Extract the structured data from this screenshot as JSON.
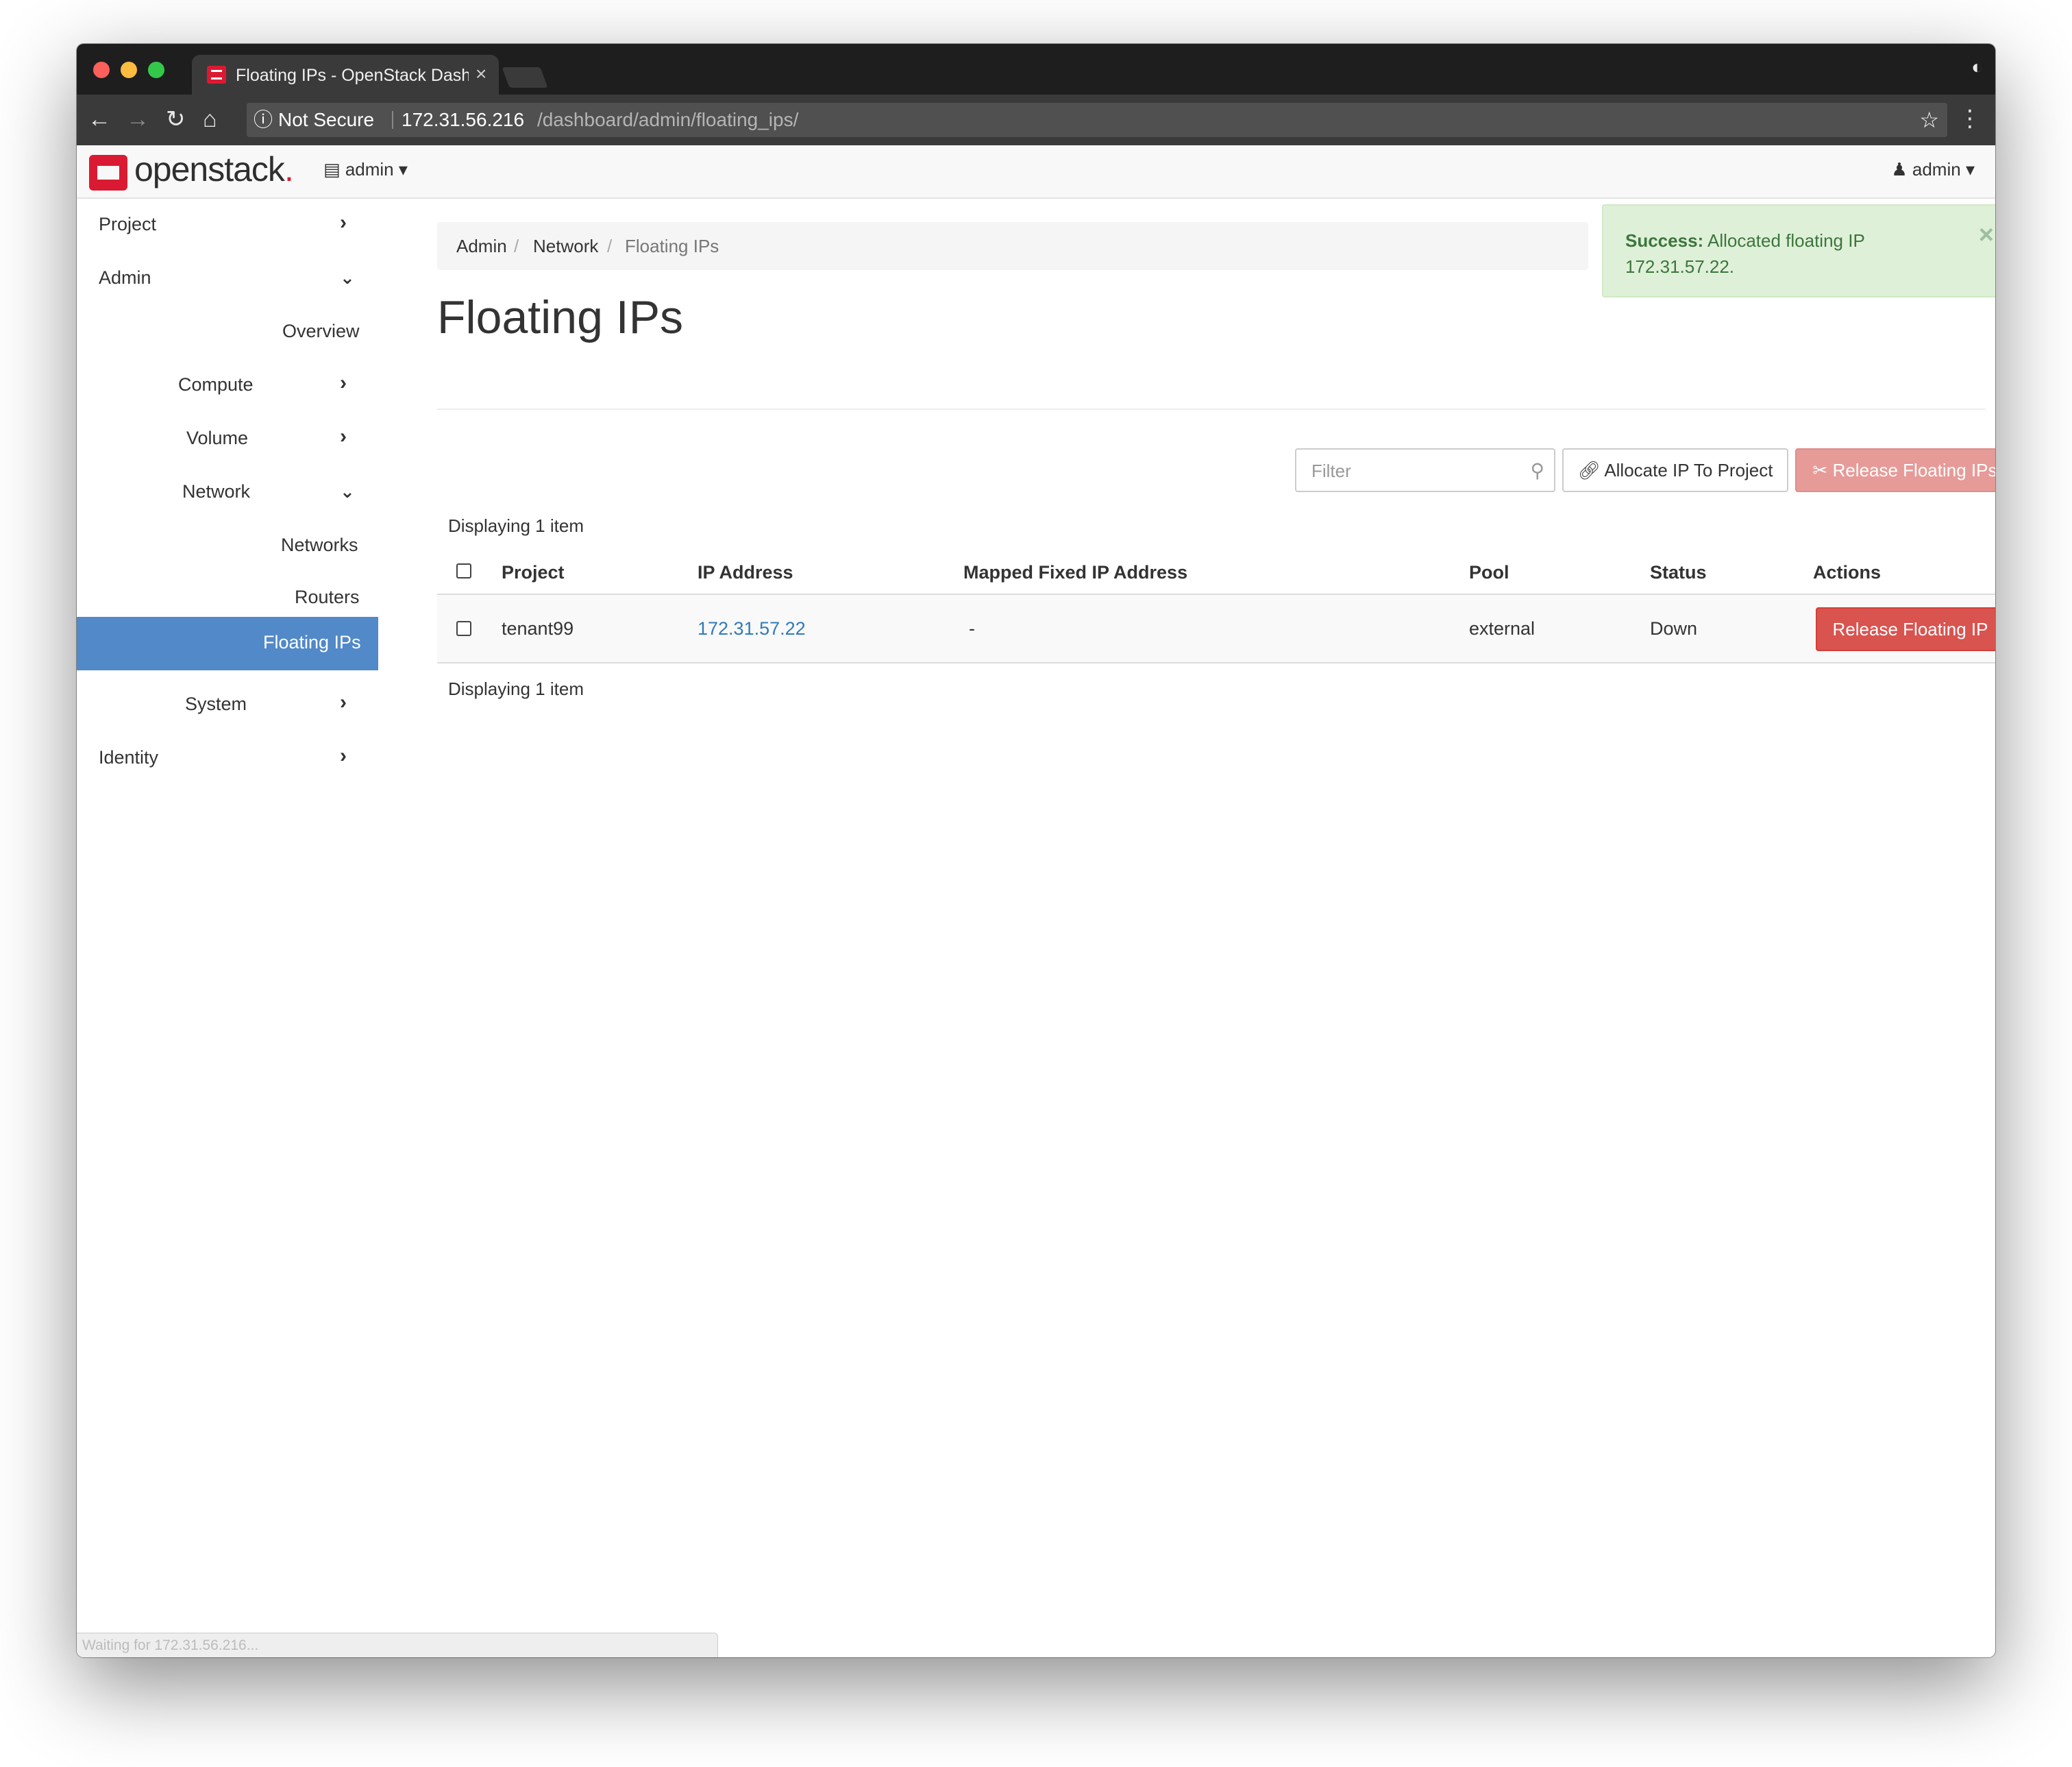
{
  "browser": {
    "tab_title": "Floating IPs - OpenStack Dashboard",
    "tab_close": "×",
    "security_label": "Not Secure",
    "url_host": "172.31.56.216",
    "url_path": "/dashboard/admin/floating_ips/",
    "status_text": "Waiting for 172.31.56.216..."
  },
  "appbar": {
    "logo_text": "openstack",
    "logo_dot": ".",
    "project_label": "admin",
    "user_label": "admin"
  },
  "sidebar": {
    "items": [
      {
        "label": "Project",
        "chevron": "right"
      },
      {
        "label": "Admin",
        "chevron": "down"
      },
      {
        "label": "Overview"
      },
      {
        "label": "Compute",
        "chevron": "right"
      },
      {
        "label": "Volume",
        "chevron": "right"
      },
      {
        "label": "Network",
        "chevron": "down"
      },
      {
        "label": "Networks"
      },
      {
        "label": "Routers"
      },
      {
        "label": "Floating IPs",
        "active": true
      },
      {
        "label": "System",
        "chevron": "right"
      },
      {
        "label": "Identity",
        "chevron": "right"
      }
    ]
  },
  "breadcrumb": [
    "Admin",
    "Network",
    "Floating IPs"
  ],
  "page_title": "Floating IPs",
  "alert": {
    "strong": "Success:",
    "message": " Allocated floating IP 172.31.57.22.",
    "close": "×"
  },
  "toolbar": {
    "filter_placeholder": "Filter",
    "allocate_label": "Allocate IP To Project",
    "release_all_label": "Release Floating IPs"
  },
  "display_count": "Displaying 1 item",
  "table": {
    "headers": [
      "Project",
      "IP Address",
      "Mapped Fixed IP Address",
      "Pool",
      "Status",
      "Actions"
    ],
    "rows": [
      {
        "project": "tenant99",
        "ip": "172.31.57.22",
        "mapped": "-",
        "pool": "external",
        "status": "Down",
        "action": "Release Floating IP"
      }
    ]
  },
  "colors": {
    "active_nav": "#5189c9",
    "danger": "#d9534f",
    "success_bg": "#dff0d8",
    "link": "#337ab7",
    "logo_red": "#da1a32"
  }
}
